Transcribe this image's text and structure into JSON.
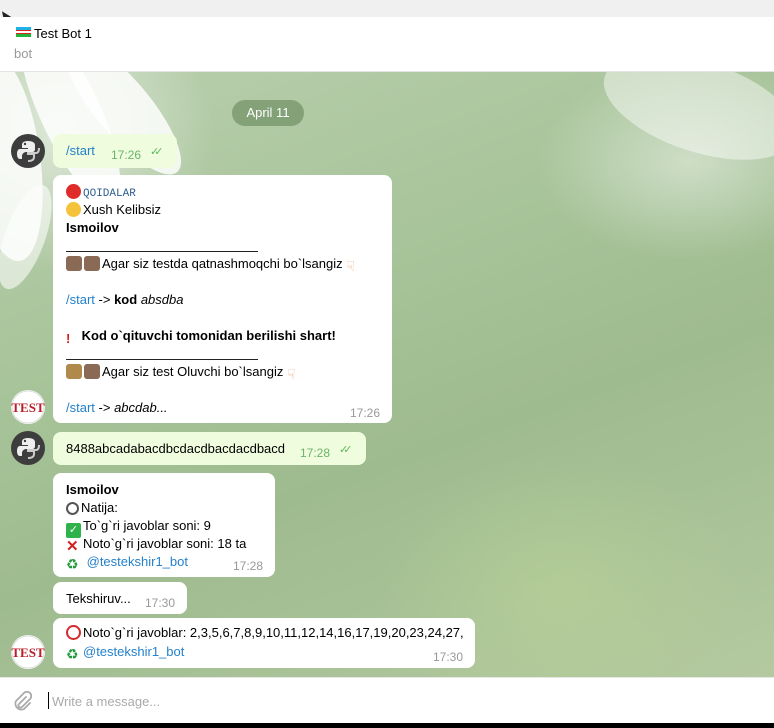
{
  "header": {
    "title": "Test Bot 1",
    "subtitle": "bot"
  },
  "chat": {
    "date_label": "April 11",
    "messages": [
      {
        "direction": "out",
        "text": "/start",
        "time": "17:26",
        "status_icon": "double-check-icon"
      },
      {
        "direction": "in",
        "lines": {
          "qoidalar": "QOIDALAR",
          "greeting": "Xush Kelibsiz",
          "name": "Ismoilov",
          "participate": "Agar siz testda qatnashmoqchi bo`lsangiz",
          "start_cmd": "/start",
          "arrow_kod": " -> ",
          "kod_word": "kod",
          "kod_value": "absdba",
          "warning": "Kod o`qituvchi tomonidan berilishi shart!",
          "teacher": "Agar siz test Oluvchi bo`lsangiz",
          "start_cmd2": "/start",
          "arrow2": " -> ",
          "abcdab": "abcdab..."
        },
        "time": "17:26"
      },
      {
        "direction": "out",
        "text": "8488abcadabacdbcdacdbacdacdbacd",
        "time": "17:28",
        "status_icon": "double-check-icon"
      },
      {
        "direction": "in",
        "lines": {
          "name": "Ismoilov",
          "natija": "Natija:",
          "correct": "To`g`ri javoblar soni: 9",
          "wrong": "Noto`g`ri javoblar soni: 18 ta",
          "bot_handle": "@testekshir1_bot"
        },
        "time": "17:28"
      },
      {
        "direction": "in",
        "text": "Tekshiruv...",
        "time": "17:30"
      },
      {
        "direction": "in",
        "lines": {
          "wrong_answers": "Noto`g`ri javoblar: 2,3,5,6,7,8,9,10,11,12,14,16,17,19,20,23,24,27,",
          "bot_handle": "@testekshir1_bot"
        },
        "time": "17:30"
      }
    ]
  },
  "composer": {
    "placeholder": "Write a message..."
  },
  "colors": {
    "outgoing_bubble": "#effdde",
    "incoming_bubble": "#ffffff",
    "link": "#2481cc",
    "check_green": "#5eb85b",
    "date_pill": "#7b9a6e"
  }
}
